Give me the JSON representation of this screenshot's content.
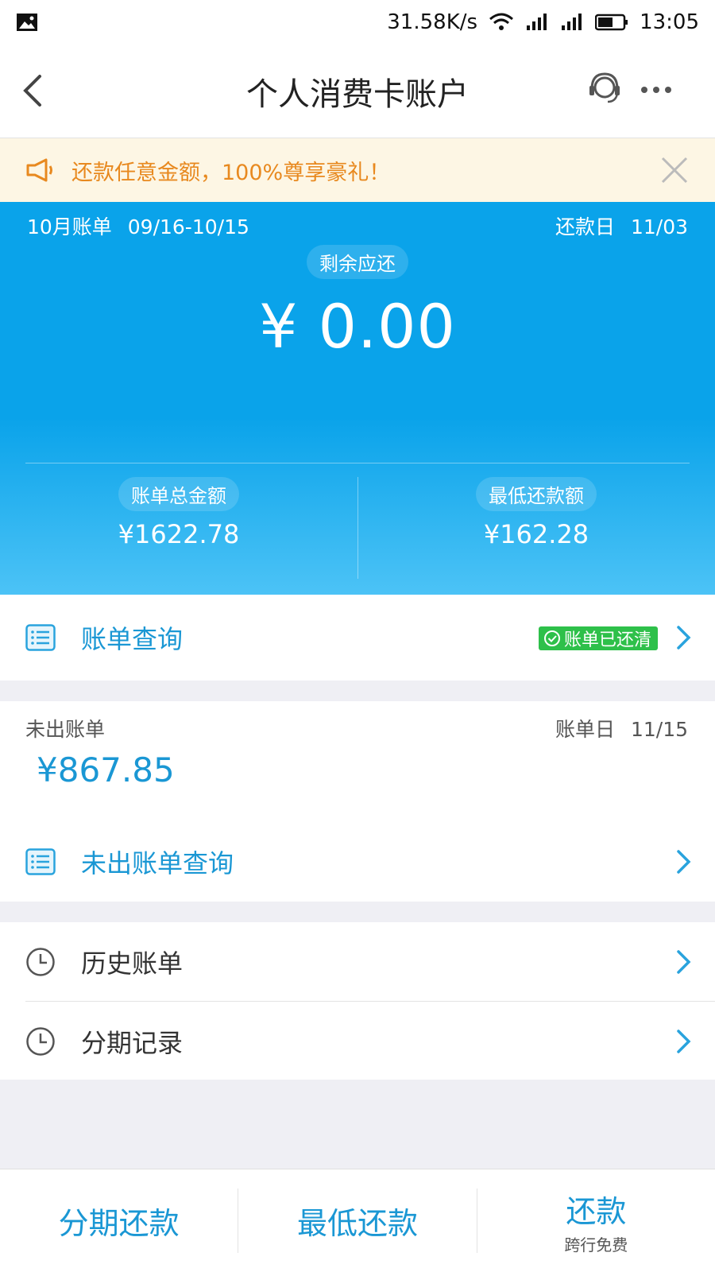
{
  "status_bar": {
    "speed": "31.58K/s",
    "time": "13:05"
  },
  "header": {
    "title": "个人消费卡账户"
  },
  "notice": {
    "text": "还款任意金额，100%尊享豪礼！"
  },
  "bill": {
    "month_label": "10月账单",
    "period": "09/16-10/15",
    "due_label": "还款日",
    "due_date": "11/03",
    "remaining_label": "剩余应还",
    "remaining_amount": "¥ 0.00",
    "total_label": "账单总金额",
    "total_amount": "¥1622.78",
    "min_label": "最低还款额",
    "min_amount": "¥162.28"
  },
  "bill_query": {
    "label": "账单查询",
    "status": "账单已还清"
  },
  "unbilled": {
    "label": "未出账单",
    "bill_day_label": "账单日",
    "bill_day": "11/15",
    "amount": "¥867.85",
    "query_label": "未出账单查询"
  },
  "history": {
    "history_label": "历史账单",
    "installment_label": "分期记录"
  },
  "footer": {
    "installment_repay": "分期还款",
    "min_repay": "最低还款",
    "repay": "还款",
    "repay_sub": "跨行免费"
  },
  "colors": {
    "accent": "#1a97d4",
    "hero_blue": "#0aa3ea",
    "notice_orange": "#e8891f",
    "badge_green": "#2ec04a"
  }
}
